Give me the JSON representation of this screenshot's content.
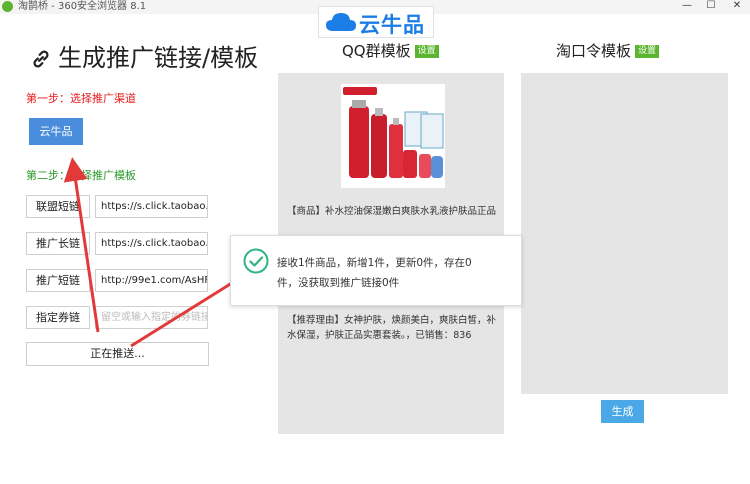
{
  "titlebar": {
    "title": "淘鹊桥 - 360安全浏览器 8.1",
    "minimize": "—",
    "maximize": "☐",
    "close": "✕"
  },
  "brand": {
    "text": "云牛品"
  },
  "heading": "生成推广链接/模板",
  "step1": {
    "label": "第一步：选择推广渠道",
    "channel_button": "云牛品"
  },
  "step2": {
    "label": "第二步：选择推广模板",
    "rows": [
      {
        "label": "联盟短链",
        "value": "https://s.click.taobao.c"
      },
      {
        "label": "推广长链",
        "value": "https://s.click.taobao.c"
      },
      {
        "label": "推广短链",
        "value": "http://99e1.com/AsHFI"
      },
      {
        "label": "指定券链",
        "placeholder": "留空或输入指定的券链接"
      }
    ]
  },
  "push_button": "正在推送...",
  "qq_panel": {
    "title": "QQ群模板",
    "settings": "设置",
    "product_text": "【商品】补水控油保湿嫩白爽肤水乳液护肤品正品",
    "recommend_text": "【推荐理由】女神护肤，焕颜美白，爽肤白皙，补水保湿，护肤正品实惠套装。，已销售：836"
  },
  "tkl_panel": {
    "title": "淘口令模板",
    "settings": "设置",
    "generate_button": "生成"
  },
  "popup": {
    "message": "接收1件商品，新增1件，更新0件，存在0件，没获取到推广链接0件"
  },
  "colors": {
    "accent_blue": "#4a8ddc",
    "badge_green": "#5cb531",
    "step1_red": "#e81c1c",
    "step2_green": "#2a9a2a",
    "arrow_red": "#e23a3a"
  }
}
